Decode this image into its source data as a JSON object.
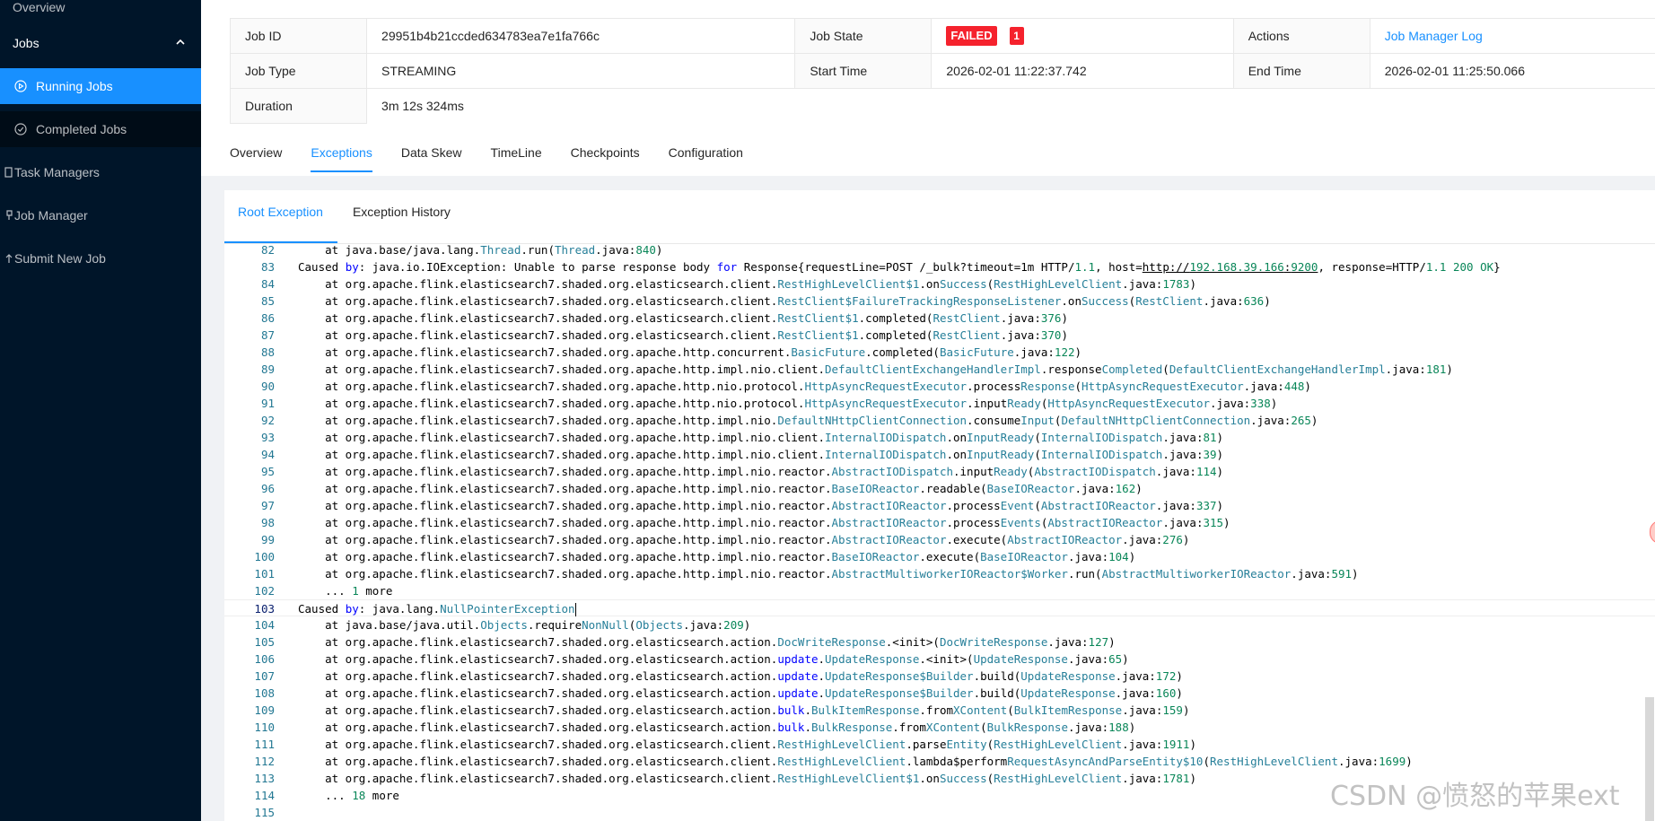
{
  "sidebar": {
    "overview": "Overview",
    "jobs": "Jobs",
    "running_jobs": "Running Jobs",
    "completed_jobs": "Completed Jobs",
    "task_managers": "Task Managers",
    "job_manager": "Job Manager",
    "submit_new_job": "Submit New Job"
  },
  "job": {
    "id_label": "Job ID",
    "id_value": "29951b4b21ccded634783ea7e1fa766c",
    "state_label": "Job State",
    "state_value": "FAILED",
    "state_count": "1",
    "actions_label": "Actions",
    "actions_link": "Job Manager Log",
    "type_label": "Job Type",
    "type_value": "STREAMING",
    "start_label": "Start Time",
    "start_value": "2026-02-01 11:22:37.742",
    "end_label": "End Time",
    "end_value": "2026-02-01 11:25:50.066",
    "duration_label": "Duration",
    "duration_value": "3m 12s 324ms"
  },
  "tabs": [
    "Overview",
    "Exceptions",
    "Data Skew",
    "TimeLine",
    "Checkpoints",
    "Configuration"
  ],
  "subtabs": [
    "Root Exception",
    "Exception History"
  ],
  "code_lines": [
    {
      "n": "82",
      "text": "    at java.base/java.lang.Thread.run(Thread.java:840)"
    },
    {
      "n": "83",
      "text": "Caused by: java.io.IOException: Unable to parse response body for Response{requestLine=POST /_bulk?timeout=1m HTTP/1.1, host=http://192.168.39.166:9200, response=HTTP/1.1 200 OK}"
    },
    {
      "n": "84",
      "text": "    at org.apache.flink.elasticsearch7.shaded.org.elasticsearch.client.RestHighLevelClient$1.onSuccess(RestHighLevelClient.java:1783)"
    },
    {
      "n": "85",
      "text": "    at org.apache.flink.elasticsearch7.shaded.org.elasticsearch.client.RestClient$FailureTrackingResponseListener.onSuccess(RestClient.java:636)"
    },
    {
      "n": "86",
      "text": "    at org.apache.flink.elasticsearch7.shaded.org.elasticsearch.client.RestClient$1.completed(RestClient.java:376)"
    },
    {
      "n": "87",
      "text": "    at org.apache.flink.elasticsearch7.shaded.org.elasticsearch.client.RestClient$1.completed(RestClient.java:370)"
    },
    {
      "n": "88",
      "text": "    at org.apache.flink.elasticsearch7.shaded.org.apache.http.concurrent.BasicFuture.completed(BasicFuture.java:122)"
    },
    {
      "n": "89",
      "text": "    at org.apache.flink.elasticsearch7.shaded.org.apache.http.impl.nio.client.DefaultClientExchangeHandlerImpl.responseCompleted(DefaultClientExchangeHandlerImpl.java:181)"
    },
    {
      "n": "90",
      "text": "    at org.apache.flink.elasticsearch7.shaded.org.apache.http.nio.protocol.HttpAsyncRequestExecutor.processResponse(HttpAsyncRequestExecutor.java:448)"
    },
    {
      "n": "91",
      "text": "    at org.apache.flink.elasticsearch7.shaded.org.apache.http.nio.protocol.HttpAsyncRequestExecutor.inputReady(HttpAsyncRequestExecutor.java:338)"
    },
    {
      "n": "92",
      "text": "    at org.apache.flink.elasticsearch7.shaded.org.apache.http.impl.nio.DefaultNHttpClientConnection.consumeInput(DefaultNHttpClientConnection.java:265)"
    },
    {
      "n": "93",
      "text": "    at org.apache.flink.elasticsearch7.shaded.org.apache.http.impl.nio.client.InternalIODispatch.onInputReady(InternalIODispatch.java:81)"
    },
    {
      "n": "94",
      "text": "    at org.apache.flink.elasticsearch7.shaded.org.apache.http.impl.nio.client.InternalIODispatch.onInputReady(InternalIODispatch.java:39)"
    },
    {
      "n": "95",
      "text": "    at org.apache.flink.elasticsearch7.shaded.org.apache.http.impl.nio.reactor.AbstractIODispatch.inputReady(AbstractIODispatch.java:114)"
    },
    {
      "n": "96",
      "text": "    at org.apache.flink.elasticsearch7.shaded.org.apache.http.impl.nio.reactor.BaseIOReactor.readable(BaseIOReactor.java:162)"
    },
    {
      "n": "97",
      "text": "    at org.apache.flink.elasticsearch7.shaded.org.apache.http.impl.nio.reactor.AbstractIOReactor.processEvent(AbstractIOReactor.java:337)"
    },
    {
      "n": "98",
      "text": "    at org.apache.flink.elasticsearch7.shaded.org.apache.http.impl.nio.reactor.AbstractIOReactor.processEvents(AbstractIOReactor.java:315)"
    },
    {
      "n": "99",
      "text": "    at org.apache.flink.elasticsearch7.shaded.org.apache.http.impl.nio.reactor.AbstractIOReactor.execute(AbstractIOReactor.java:276)"
    },
    {
      "n": "100",
      "text": "    at org.apache.flink.elasticsearch7.shaded.org.apache.http.impl.nio.reactor.BaseIOReactor.execute(BaseIOReactor.java:104)"
    },
    {
      "n": "101",
      "text": "    at org.apache.flink.elasticsearch7.shaded.org.apache.http.impl.nio.reactor.AbstractMultiworkerIOReactor$Worker.run(AbstractMultiworkerIOReactor.java:591)"
    },
    {
      "n": "102",
      "text": "    ... 1 more"
    },
    {
      "n": "103",
      "text": "Caused by: java.lang.NullPointerException"
    },
    {
      "n": "104",
      "text": "    at java.base/java.util.Objects.requireNonNull(Objects.java:209)"
    },
    {
      "n": "105",
      "text": "    at org.apache.flink.elasticsearch7.shaded.org.elasticsearch.action.DocWriteResponse.<init>(DocWriteResponse.java:127)"
    },
    {
      "n": "106",
      "text": "    at org.apache.flink.elasticsearch7.shaded.org.elasticsearch.action.update.UpdateResponse.<init>(UpdateResponse.java:65)"
    },
    {
      "n": "107",
      "text": "    at org.apache.flink.elasticsearch7.shaded.org.elasticsearch.action.update.UpdateResponse$Builder.build(UpdateResponse.java:172)"
    },
    {
      "n": "108",
      "text": "    at org.apache.flink.elasticsearch7.shaded.org.elasticsearch.action.update.UpdateResponse$Builder.build(UpdateResponse.java:160)"
    },
    {
      "n": "109",
      "text": "    at org.apache.flink.elasticsearch7.shaded.org.elasticsearch.action.bulk.BulkItemResponse.fromXContent(BulkItemResponse.java:159)"
    },
    {
      "n": "110",
      "text": "    at org.apache.flink.elasticsearch7.shaded.org.elasticsearch.action.bulk.BulkResponse.fromXContent(BulkResponse.java:188)"
    },
    {
      "n": "111",
      "text": "    at org.apache.flink.elasticsearch7.shaded.org.elasticsearch.client.RestHighLevelClient.parseEntity(RestHighLevelClient.java:1911)"
    },
    {
      "n": "112",
      "text": "    at org.apache.flink.elasticsearch7.shaded.org.elasticsearch.client.RestHighLevelClient.lambda$performRequestAsyncAndParseEntity$10(RestHighLevelClient.java:1699)"
    },
    {
      "n": "113",
      "text": "    at org.apache.flink.elasticsearch7.shaded.org.elasticsearch.client.RestHighLevelClient$1.onSuccess(RestHighLevelClient.java:1781)"
    },
    {
      "n": "114",
      "text": "    ... 18 more"
    },
    {
      "n": "115",
      "text": ""
    }
  ],
  "watermark": "CSDN @愤怒的苹果ext",
  "colors": {
    "accent": "#1890ff",
    "failed": "#f5222d",
    "sidebar": "#001529"
  }
}
